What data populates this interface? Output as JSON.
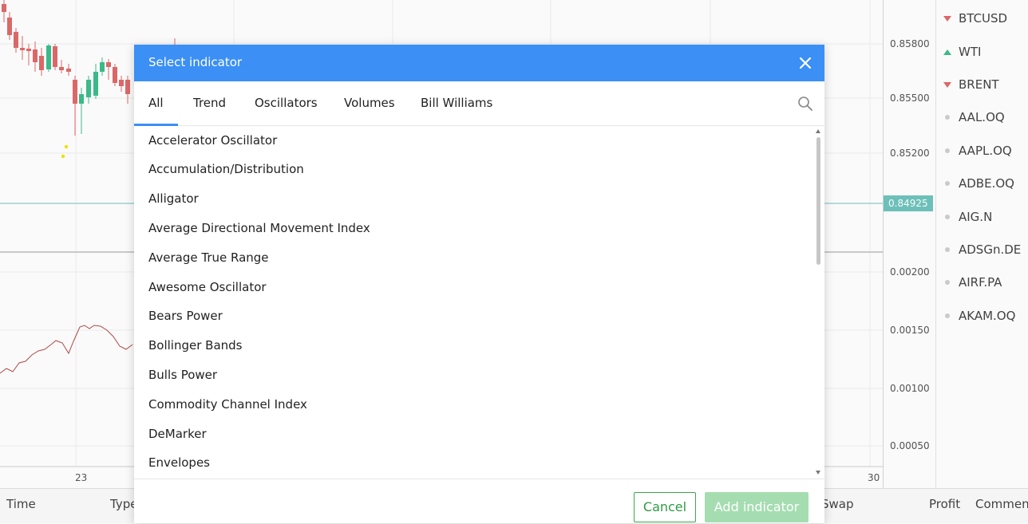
{
  "chart": {
    "price_labels": [
      "0.85800",
      "0.85500",
      "0.85200",
      "0.00200",
      "0.00150",
      "0.00100",
      "0.00050"
    ],
    "current_price": "0.84925",
    "time_labels": [
      "23",
      "30"
    ]
  },
  "symbols": [
    {
      "label": "BTCUSD",
      "trend": "down"
    },
    {
      "label": "WTI",
      "trend": "up"
    },
    {
      "label": "BRENT",
      "trend": "down"
    },
    {
      "label": "AAL.OQ",
      "trend": "none"
    },
    {
      "label": "AAPL.OQ",
      "trend": "none"
    },
    {
      "label": "ADBE.OQ",
      "trend": "none"
    },
    {
      "label": "AIG.N",
      "trend": "none"
    },
    {
      "label": "ADSGn.DE",
      "trend": "none"
    },
    {
      "label": "AIRF.PA",
      "trend": "none"
    },
    {
      "label": "AKAM.OQ",
      "trend": "none"
    }
  ],
  "bottom_bar": {
    "columns": [
      "Time",
      "Type",
      "Swap",
      "Profit",
      "Comment"
    ]
  },
  "dialog": {
    "title": "Select indicator",
    "tabs": [
      "All",
      "Trend",
      "Oscillators",
      "Volumes",
      "Bill Williams"
    ],
    "active_tab": "All",
    "items": [
      "Accelerator Oscillator",
      "Accumulation/Distribution",
      "Alligator",
      "Average Directional Movement Index",
      "Average True Range",
      "Awesome Oscillator",
      "Bears Power",
      "Bollinger Bands",
      "Bulls Power",
      "Commodity Channel Index",
      "DeMarker",
      "Envelopes"
    ],
    "cancel_label": "Cancel",
    "add_label": "Add indicator"
  },
  "colors": {
    "accent": "#3b8ff5",
    "up": "#3ebd8c",
    "down": "#e06b6b",
    "price_tag": "#6fc4bd",
    "cancel_green": "#2f9a45",
    "add_disabled": "#a5ddb1"
  }
}
